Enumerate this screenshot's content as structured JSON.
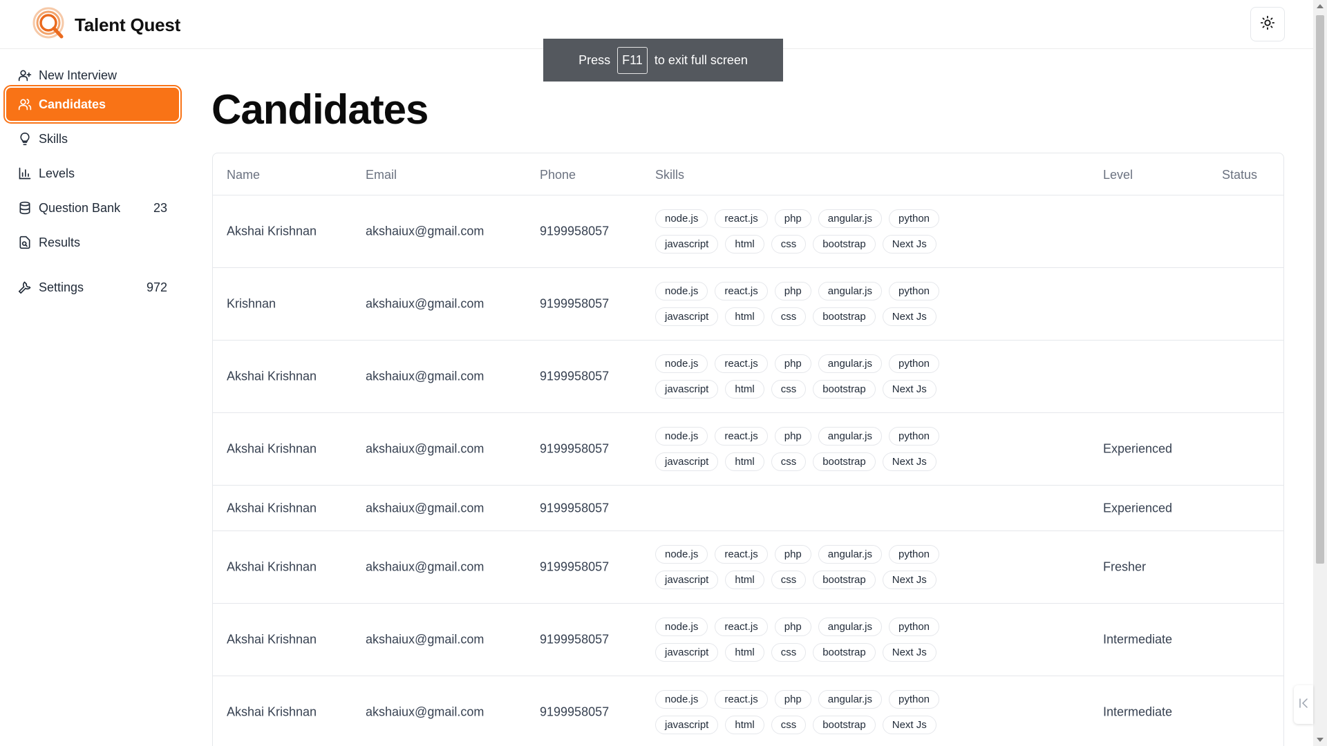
{
  "app": {
    "name": "Talent Quest"
  },
  "colors": {
    "accent": "#f97316",
    "toast_bg": "#54585e"
  },
  "sidebar": {
    "items": [
      {
        "label": "New Interview",
        "icon": "user-plus-icon",
        "active": false,
        "count": null
      },
      {
        "label": "Candidates",
        "icon": "users-icon",
        "active": true,
        "count": null
      },
      {
        "label": "Skills",
        "icon": "lightbulb-icon",
        "active": false,
        "count": null
      },
      {
        "label": "Levels",
        "icon": "bar-chart-icon",
        "active": false,
        "count": null
      },
      {
        "label": "Question Bank",
        "icon": "database-icon",
        "active": false,
        "count": "23"
      },
      {
        "label": "Results",
        "icon": "file-results-icon",
        "active": false,
        "count": null
      },
      {
        "label": "Settings",
        "icon": "wrench-icon",
        "active": false,
        "count": "972"
      }
    ]
  },
  "toast": {
    "prefix": "Press",
    "key": "F11",
    "suffix": "to exit full screen"
  },
  "page": {
    "title": "Candidates"
  },
  "table": {
    "headers": {
      "name": "Name",
      "email": "Email",
      "phone": "Phone",
      "skills": "Skills",
      "level": "Level",
      "status": "Status"
    },
    "skill_chips": [
      "node.js",
      "react.js",
      "php",
      "angular.js",
      "python",
      "javascript",
      "html",
      "css",
      "bootstrap",
      "Next Js"
    ],
    "rows": [
      {
        "name": "Akshai Krishnan",
        "email": "akshaiux@gmail.com",
        "phone": "9199958057",
        "has_skills": true,
        "level": "",
        "status": ""
      },
      {
        "name": "Krishnan",
        "email": "akshaiux@gmail.com",
        "phone": "9199958057",
        "has_skills": true,
        "level": "",
        "status": ""
      },
      {
        "name": "Akshai Krishnan",
        "email": "akshaiux@gmail.com",
        "phone": "9199958057",
        "has_skills": true,
        "level": "",
        "status": ""
      },
      {
        "name": "Akshai Krishnan",
        "email": "akshaiux@gmail.com",
        "phone": "9199958057",
        "has_skills": true,
        "level": "Experienced",
        "status": ""
      },
      {
        "name": "Akshai Krishnan",
        "email": "akshaiux@gmail.com",
        "phone": "9199958057",
        "has_skills": false,
        "level": "Experienced",
        "status": ""
      },
      {
        "name": "Akshai Krishnan",
        "email": "akshaiux@gmail.com",
        "phone": "9199958057",
        "has_skills": true,
        "level": "Fresher",
        "status": ""
      },
      {
        "name": "Akshai Krishnan",
        "email": "akshaiux@gmail.com",
        "phone": "9199958057",
        "has_skills": true,
        "level": "Intermediate",
        "status": ""
      },
      {
        "name": "Akshai Krishnan",
        "email": "akshaiux@gmail.com",
        "phone": "9199958057",
        "has_skills": true,
        "level": "Intermediate",
        "status": ""
      }
    ]
  }
}
